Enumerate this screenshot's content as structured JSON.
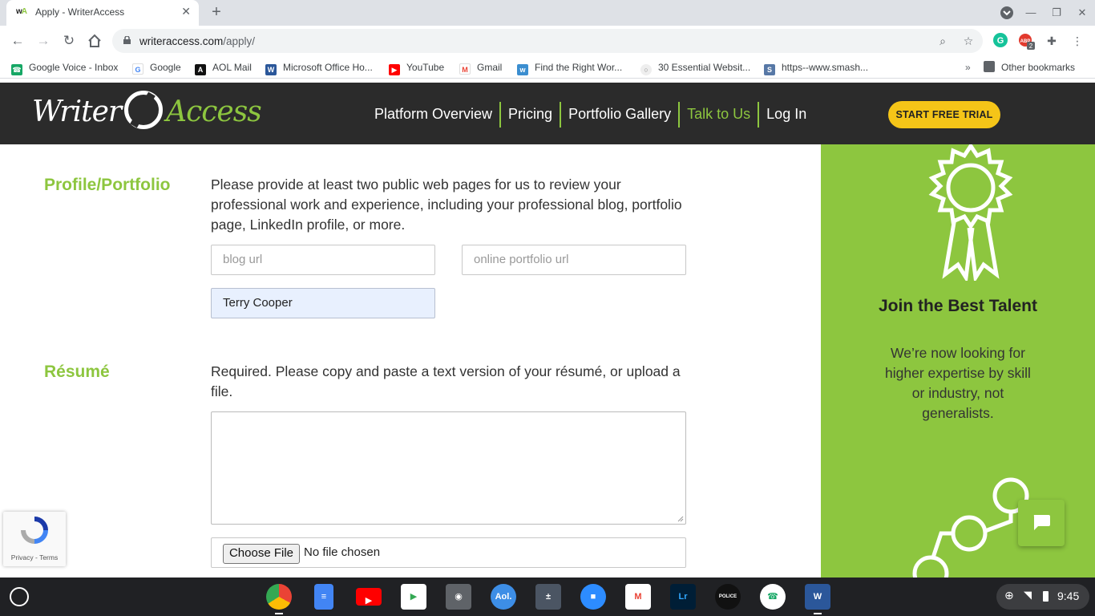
{
  "browser": {
    "tab_title": "Apply - WriterAccess",
    "url_host": "writeraccess.com",
    "url_path": "/apply/",
    "bookmarks": [
      {
        "label": "Google Voice - Inbox",
        "icon": "google-voice-icon"
      },
      {
        "label": "Google",
        "icon": "google-icon"
      },
      {
        "label": "AOL Mail",
        "icon": "aol-icon"
      },
      {
        "label": "Microsoft Office Ho...",
        "icon": "word-icon"
      },
      {
        "label": "YouTube",
        "icon": "youtube-icon"
      },
      {
        "label": "Gmail",
        "icon": "gmail-icon"
      },
      {
        "label": "Find the Right Wor...",
        "icon": "wordhippo-icon"
      },
      {
        "label": "30 Essential Websit...",
        "icon": "site-icon"
      },
      {
        "label": "https--www.smash...",
        "icon": "smashing-icon"
      }
    ],
    "other_bookmarks": "Other bookmarks",
    "extension_badge": "2"
  },
  "site": {
    "logo_left": "Writer",
    "logo_right": "Access",
    "nav": [
      "Platform Overview",
      "Pricing",
      "Portfolio Gallery",
      "Talk to Us",
      "Log In"
    ],
    "cta": "START FREE TRIAL"
  },
  "form": {
    "profile": {
      "heading": "Profile/Portfolio",
      "description": "Please provide at least two public web pages for us to review your professional work and experience, including your professional blog, portfolio page, LinkedIn profile, or more.",
      "blog_placeholder": "blog url",
      "portfolio_placeholder": "online portfolio url",
      "third_value": "Terry Cooper"
    },
    "resume": {
      "heading": "Résumé",
      "description": "Required. Please copy and paste a text version of your résumé, or upload a file.",
      "choose_file": "Choose File",
      "no_file": "No file chosen"
    }
  },
  "sidebar": {
    "title": "Join the Best Talent",
    "text": "We’re now looking for higher expertise by skill or industry, not generalists."
  },
  "recaptcha": {
    "links": "Privacy - Terms"
  },
  "taskbar": {
    "apps": [
      "chrome",
      "docs",
      "youtube",
      "play-store",
      "camera",
      "aol",
      "calculator",
      "zoom",
      "gmail",
      "lightroom",
      "police-scanner",
      "phone",
      "word"
    ],
    "time": "9:45"
  },
  "colors": {
    "accent_green": "#8dc63f",
    "header_dark": "#2b2b2b",
    "cta_yellow": "#f5c518"
  }
}
